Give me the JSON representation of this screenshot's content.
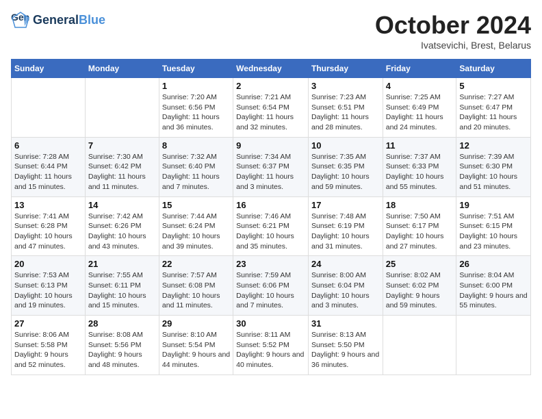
{
  "header": {
    "logo_line1": "General",
    "logo_line2": "Blue",
    "month_title": "October 2024",
    "subtitle": "Ivatsevichi, Brest, Belarus"
  },
  "weekdays": [
    "Sunday",
    "Monday",
    "Tuesday",
    "Wednesday",
    "Thursday",
    "Friday",
    "Saturday"
  ],
  "weeks": [
    [
      {
        "day": "",
        "info": ""
      },
      {
        "day": "",
        "info": ""
      },
      {
        "day": "1",
        "info": "Sunrise: 7:20 AM\nSunset: 6:56 PM\nDaylight: 11 hours and 36 minutes."
      },
      {
        "day": "2",
        "info": "Sunrise: 7:21 AM\nSunset: 6:54 PM\nDaylight: 11 hours and 32 minutes."
      },
      {
        "day": "3",
        "info": "Sunrise: 7:23 AM\nSunset: 6:51 PM\nDaylight: 11 hours and 28 minutes."
      },
      {
        "day": "4",
        "info": "Sunrise: 7:25 AM\nSunset: 6:49 PM\nDaylight: 11 hours and 24 minutes."
      },
      {
        "day": "5",
        "info": "Sunrise: 7:27 AM\nSunset: 6:47 PM\nDaylight: 11 hours and 20 minutes."
      }
    ],
    [
      {
        "day": "6",
        "info": "Sunrise: 7:28 AM\nSunset: 6:44 PM\nDaylight: 11 hours and 15 minutes."
      },
      {
        "day": "7",
        "info": "Sunrise: 7:30 AM\nSunset: 6:42 PM\nDaylight: 11 hours and 11 minutes."
      },
      {
        "day": "8",
        "info": "Sunrise: 7:32 AM\nSunset: 6:40 PM\nDaylight: 11 hours and 7 minutes."
      },
      {
        "day": "9",
        "info": "Sunrise: 7:34 AM\nSunset: 6:37 PM\nDaylight: 11 hours and 3 minutes."
      },
      {
        "day": "10",
        "info": "Sunrise: 7:35 AM\nSunset: 6:35 PM\nDaylight: 10 hours and 59 minutes."
      },
      {
        "day": "11",
        "info": "Sunrise: 7:37 AM\nSunset: 6:33 PM\nDaylight: 10 hours and 55 minutes."
      },
      {
        "day": "12",
        "info": "Sunrise: 7:39 AM\nSunset: 6:30 PM\nDaylight: 10 hours and 51 minutes."
      }
    ],
    [
      {
        "day": "13",
        "info": "Sunrise: 7:41 AM\nSunset: 6:28 PM\nDaylight: 10 hours and 47 minutes."
      },
      {
        "day": "14",
        "info": "Sunrise: 7:42 AM\nSunset: 6:26 PM\nDaylight: 10 hours and 43 minutes."
      },
      {
        "day": "15",
        "info": "Sunrise: 7:44 AM\nSunset: 6:24 PM\nDaylight: 10 hours and 39 minutes."
      },
      {
        "day": "16",
        "info": "Sunrise: 7:46 AM\nSunset: 6:21 PM\nDaylight: 10 hours and 35 minutes."
      },
      {
        "day": "17",
        "info": "Sunrise: 7:48 AM\nSunset: 6:19 PM\nDaylight: 10 hours and 31 minutes."
      },
      {
        "day": "18",
        "info": "Sunrise: 7:50 AM\nSunset: 6:17 PM\nDaylight: 10 hours and 27 minutes."
      },
      {
        "day": "19",
        "info": "Sunrise: 7:51 AM\nSunset: 6:15 PM\nDaylight: 10 hours and 23 minutes."
      }
    ],
    [
      {
        "day": "20",
        "info": "Sunrise: 7:53 AM\nSunset: 6:13 PM\nDaylight: 10 hours and 19 minutes."
      },
      {
        "day": "21",
        "info": "Sunrise: 7:55 AM\nSunset: 6:11 PM\nDaylight: 10 hours and 15 minutes."
      },
      {
        "day": "22",
        "info": "Sunrise: 7:57 AM\nSunset: 6:08 PM\nDaylight: 10 hours and 11 minutes."
      },
      {
        "day": "23",
        "info": "Sunrise: 7:59 AM\nSunset: 6:06 PM\nDaylight: 10 hours and 7 minutes."
      },
      {
        "day": "24",
        "info": "Sunrise: 8:00 AM\nSunset: 6:04 PM\nDaylight: 10 hours and 3 minutes."
      },
      {
        "day": "25",
        "info": "Sunrise: 8:02 AM\nSunset: 6:02 PM\nDaylight: 9 hours and 59 minutes."
      },
      {
        "day": "26",
        "info": "Sunrise: 8:04 AM\nSunset: 6:00 PM\nDaylight: 9 hours and 55 minutes."
      }
    ],
    [
      {
        "day": "27",
        "info": "Sunrise: 8:06 AM\nSunset: 5:58 PM\nDaylight: 9 hours and 52 minutes."
      },
      {
        "day": "28",
        "info": "Sunrise: 8:08 AM\nSunset: 5:56 PM\nDaylight: 9 hours and 48 minutes."
      },
      {
        "day": "29",
        "info": "Sunrise: 8:10 AM\nSunset: 5:54 PM\nDaylight: 9 hours and 44 minutes."
      },
      {
        "day": "30",
        "info": "Sunrise: 8:11 AM\nSunset: 5:52 PM\nDaylight: 9 hours and 40 minutes."
      },
      {
        "day": "31",
        "info": "Sunrise: 8:13 AM\nSunset: 5:50 PM\nDaylight: 9 hours and 36 minutes."
      },
      {
        "day": "",
        "info": ""
      },
      {
        "day": "",
        "info": ""
      }
    ]
  ]
}
